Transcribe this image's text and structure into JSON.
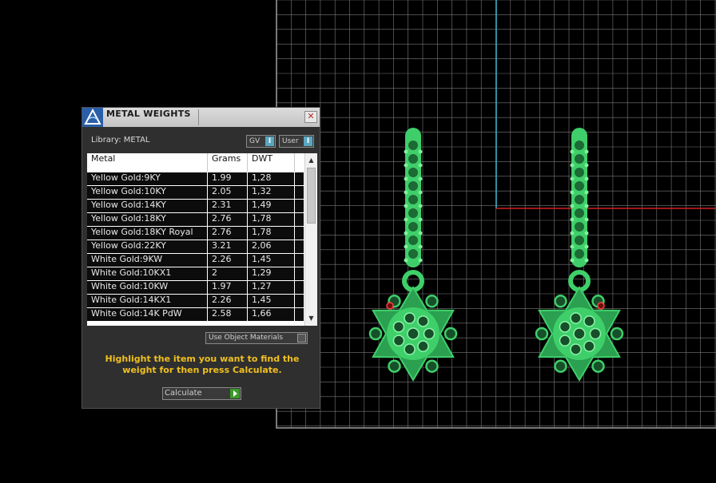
{
  "panel": {
    "title": "METAL WEIGHTS",
    "close_symbol": "✕",
    "library_label": "Library: METAL",
    "toggles": [
      {
        "label": "GV",
        "state": "I"
      },
      {
        "label": "User",
        "state": "I"
      }
    ],
    "table": {
      "headers": [
        "Metal",
        "Grams",
        "DWT"
      ],
      "rows": [
        [
          "Yellow Gold:9KY",
          "1.99",
          "1,28"
        ],
        [
          "Yellow Gold:10KY",
          "2.05",
          "1,32"
        ],
        [
          "Yellow Gold:14KY",
          "2.31",
          "1,49"
        ],
        [
          "Yellow Gold:18KY",
          "2.76",
          "1,78"
        ],
        [
          "Yellow Gold:18KY Royal",
          "2.76",
          "1,78"
        ],
        [
          "Yellow Gold:22KY",
          "3.21",
          "2,06"
        ],
        [
          "White Gold:9KW",
          "2.26",
          "1,45"
        ],
        [
          "White Gold:10KX1",
          "2",
          "1,29"
        ],
        [
          "White Gold:10KW",
          "1.97",
          "1,27"
        ],
        [
          "White Gold:14KX1",
          "2.26",
          "1,45"
        ],
        [
          "White Gold:14K PdW",
          "2.58",
          "1,66"
        ]
      ]
    },
    "scroll_up": "▲",
    "scroll_down": "▼",
    "use_object_materials": "Use Object Materials",
    "hint": "Highlight the item you want to find the weight for then press Calculate.",
    "calculate_label": "Calculate"
  },
  "viewport": {
    "grid_color": "#7a7a7a",
    "axis_y_color": "#3ab0c8",
    "axis_x_color": "#d02020",
    "model_color": "#3fcf6a"
  }
}
